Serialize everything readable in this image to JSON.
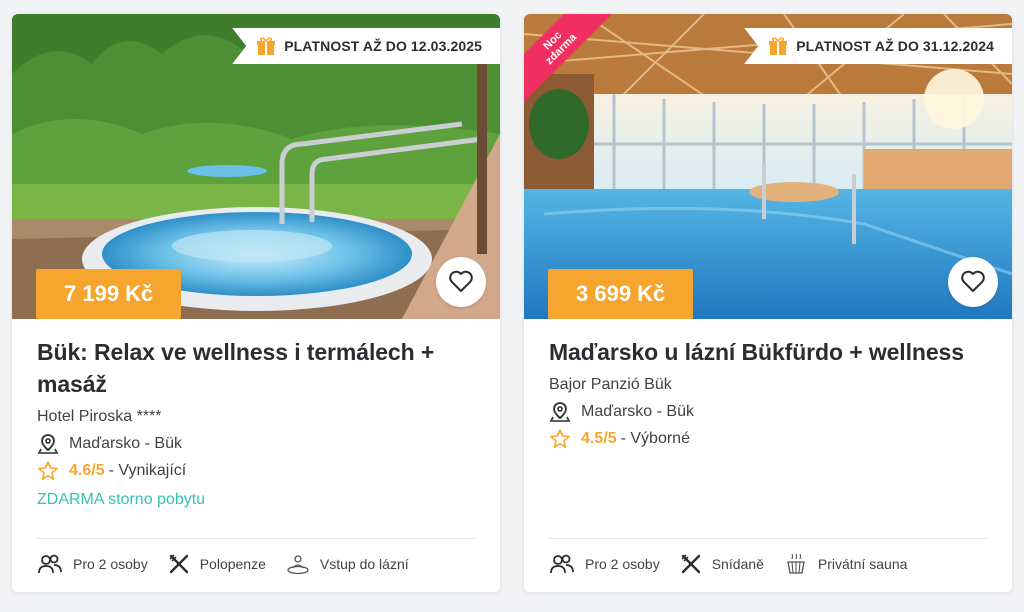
{
  "cards": [
    {
      "validity": "PLATNOST AŽ DO 12.03.2025",
      "price": "7 199 Kč",
      "title": "Bük: Relax ve wellness i termálech + masáž",
      "hotel": "Hotel Piroska ****",
      "location": "Maďarsko - Bük",
      "rating_value": "4.6/5",
      "rating_text": "- Vynikající",
      "free_cancel": "ZDARMA storno pobytu",
      "amenities": [
        "Pro 2 osoby",
        "Polopenze",
        "Vstup do lázní"
      ]
    },
    {
      "ribbon_line1": "Noc",
      "ribbon_line2": "zdarma",
      "validity": "PLATNOST AŽ DO 31.12.2024",
      "price": "3 699 Kč",
      "title": "Maďarsko u lázní Bükfürdo + wellness",
      "hotel": "Bajor Panzió Bük",
      "location": "Maďarsko - Bük",
      "rating_value": "4.5/5",
      "rating_text": "- Výborné",
      "amenities": [
        "Pro 2 osoby",
        "Snídaně",
        "Privátní sauna"
      ]
    }
  ],
  "colors": {
    "price_bg": "#f6a52e",
    "rating": "#f6a52e",
    "free_cancel": "#36c2b4",
    "ribbon": "#ef2e62"
  },
  "icons": [
    "gift-icon",
    "heart-icon",
    "location-pin-icon",
    "star-icon",
    "people-icon",
    "cutlery-icon",
    "spa-icon",
    "sauna-icon"
  ]
}
